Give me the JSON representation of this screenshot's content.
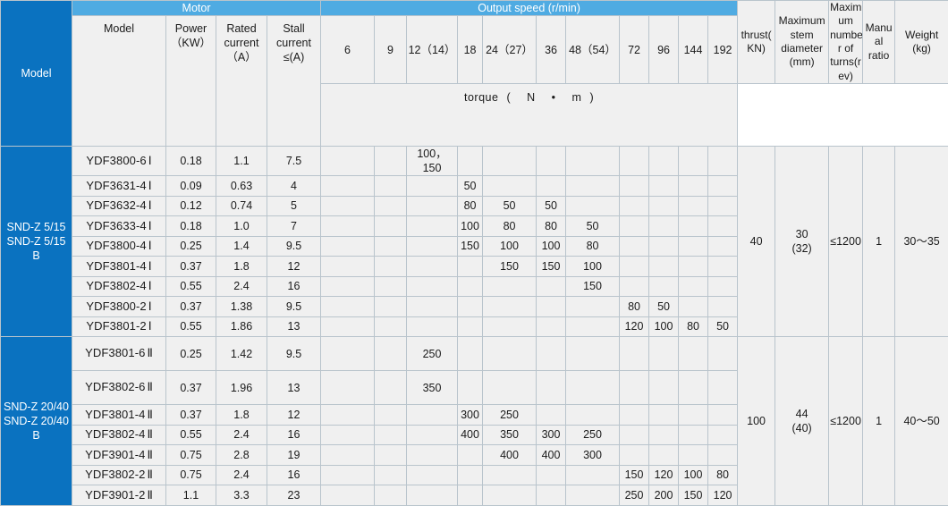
{
  "header": {
    "model_col": "Model",
    "motor_group": "Motor",
    "motor_sub": [
      "Model",
      "Power（KW）",
      "Rated current（A）",
      "Stall current ≤(A)"
    ],
    "motor_sub_lines": [
      [
        "Model"
      ],
      [
        "Power",
        "（KW）"
      ],
      [
        "Rated",
        "current",
        "（A）"
      ],
      [
        "Stall",
        "current",
        "≤(A)"
      ]
    ],
    "output_speed_group": "Output speed (r/min)",
    "speeds": [
      "6",
      "9",
      "12（14）",
      "18",
      "24（27）",
      "36",
      "48（54）",
      "72",
      "96",
      "144",
      "192"
    ],
    "torque_label": "torque（N • m）",
    "torque_parts": [
      "torque",
      "(",
      "N",
      "•",
      "m",
      ")"
    ],
    "thrust": "thrust(KN)",
    "thrust_lines": [
      "thrust(",
      "KN)"
    ],
    "max_stem_diameter": "Maximum stem diameter (mm)",
    "max_stem_diameter_lines": [
      "Maximum",
      "stem",
      "diameter",
      "(mm)"
    ],
    "max_turns": "Maximum number of turns(rev)",
    "max_turns_lines": [
      "Maxim",
      "um",
      "numbe",
      "r of",
      "turns(r",
      "ev)"
    ],
    "manual_ratio": "Manual ratio",
    "manual_ratio_lines": [
      "Manu",
      "al",
      "ratio"
    ],
    "weight": "Weight (kg)",
    "weight_lines": [
      "Weight",
      "(kg)"
    ]
  },
  "colors": {
    "header_dark_blue": "#0a72c0",
    "header_light_blue": "#4fabe2",
    "grid_line": "#b9c4cc",
    "cell_bg": "#f0f0f0",
    "body_bg": "#fbfbfb"
  },
  "groups": [
    {
      "name_lines": [
        "SND-Z 5/15",
        "SND-Z 5/15",
        "B"
      ],
      "thrust": "40",
      "stem_diameter_lines": [
        "30",
        "(32)"
      ],
      "max_turns": "≤1200",
      "manual_ratio": "1",
      "weight": "30～35",
      "rows": [
        {
          "model": "YDF3800-6",
          "roman": "Ⅰ",
          "power": "0.18",
          "rated": "1.1",
          "stall": "7.5",
          "torque": [
            "",
            "",
            "100，150",
            "",
            "",
            "",
            "",
            "",
            "",
            "",
            ""
          ]
        },
        {
          "model": "YDF3631-4",
          "roman": "Ⅰ",
          "power": "0.09",
          "rated": "0.63",
          "stall": "4",
          "torque": [
            "",
            "",
            "",
            "50",
            "",
            "",
            "",
            "",
            "",
            "",
            ""
          ]
        },
        {
          "model": "YDF3632-4",
          "roman": "Ⅰ",
          "power": "0.12",
          "rated": "0.74",
          "stall": "5",
          "torque": [
            "",
            "",
            "",
            "80",
            "50",
            "50",
            "",
            "",
            "",
            "",
            ""
          ]
        },
        {
          "model": "YDF3633-4",
          "roman": "Ⅰ",
          "power": "0.18",
          "rated": "1.0",
          "stall": "7",
          "torque": [
            "",
            "",
            "",
            "100",
            "80",
            "80",
            "50",
            "",
            "",
            "",
            ""
          ]
        },
        {
          "model": "YDF3800-4",
          "roman": "Ⅰ",
          "power": "0.25",
          "rated": "1.4",
          "stall": "9.5",
          "torque": [
            "",
            "",
            "",
            "150",
            "100",
            "100",
            "80",
            "",
            "",
            "",
            ""
          ]
        },
        {
          "model": "YDF3801-4",
          "roman": "Ⅰ",
          "power": "0.37",
          "rated": "1.8",
          "stall": "12",
          "torque": [
            "",
            "",
            "",
            "",
            "150",
            "150",
            "100",
            "",
            "",
            "",
            ""
          ]
        },
        {
          "model": "YDF3802-4",
          "roman": "Ⅰ",
          "power": "0.55",
          "rated": "2.4",
          "stall": "16",
          "torque": [
            "",
            "",
            "",
            "",
            "",
            "",
            "150",
            "",
            "",
            "",
            ""
          ]
        },
        {
          "model": "YDF3800-2",
          "roman": "Ⅰ",
          "power": "0.37",
          "rated": "1.38",
          "stall": "9.5",
          "torque": [
            "",
            "",
            "",
            "",
            "",
            "",
            "",
            "80",
            "50",
            "",
            ""
          ]
        },
        {
          "model": "YDF3801-2",
          "roman": "Ⅰ",
          "power": "0.55",
          "rated": "1.86",
          "stall": "13",
          "torque": [
            "",
            "",
            "",
            "",
            "",
            "",
            "",
            "120",
            "100",
            "80",
            "50"
          ]
        }
      ]
    },
    {
      "name_lines": [
        "SND-Z 20/40",
        "SND-Z 20/40",
        "B"
      ],
      "thrust": "100",
      "stem_diameter_lines": [
        "44",
        "(40)"
      ],
      "max_turns": "≤1200",
      "manual_ratio": "1",
      "weight": "40～50",
      "rows": [
        {
          "model": "YDF3801-6",
          "roman": "Ⅱ",
          "power": "0.25",
          "rated": "1.42",
          "stall": "9.5",
          "tall": true,
          "torque": [
            "",
            "",
            "250",
            "",
            "",
            "",
            "",
            "",
            "",
            "",
            ""
          ]
        },
        {
          "model": "YDF3802-6",
          "roman": "Ⅱ",
          "power": "0.37",
          "rated": "1.96",
          "stall": "13",
          "tall": true,
          "torque": [
            "",
            "",
            "350",
            "",
            "",
            "",
            "",
            "",
            "",
            "",
            ""
          ]
        },
        {
          "model": "YDF3801-4",
          "roman": "Ⅱ",
          "power": "0.37",
          "rated": "1.8",
          "stall": "12",
          "tall": false,
          "torque": [
            "",
            "",
            "",
            "300",
            "250",
            "",
            "",
            "",
            "",
            "",
            ""
          ]
        },
        {
          "model": "YDF3802-4",
          "roman": "Ⅱ",
          "power": "0.55",
          "rated": "2.4",
          "stall": "16",
          "tall": false,
          "torque": [
            "",
            "",
            "",
            "400",
            "350",
            "300",
            "250",
            "",
            "",
            "",
            ""
          ]
        },
        {
          "model": "YDF3901-4",
          "roman": "Ⅱ",
          "power": "0.75",
          "rated": "2.8",
          "stall": "19",
          "tall": false,
          "torque": [
            "",
            "",
            "",
            "",
            "400",
            "400",
            "300",
            "",
            "",
            "",
            ""
          ]
        },
        {
          "model": "YDF3802-2",
          "roman": "Ⅱ",
          "power": "0.75",
          "rated": "2.4",
          "stall": "16",
          "tall": false,
          "torque": [
            "",
            "",
            "",
            "",
            "",
            "",
            "",
            "150",
            "120",
            "100",
            "80"
          ]
        },
        {
          "model": "YDF3901-2",
          "roman": "Ⅱ",
          "power": "1.1",
          "rated": "3.3",
          "stall": "23",
          "tall": false,
          "torque": [
            "",
            "",
            "",
            "",
            "",
            "",
            "",
            "250",
            "200",
            "150",
            "120"
          ]
        }
      ]
    }
  ]
}
